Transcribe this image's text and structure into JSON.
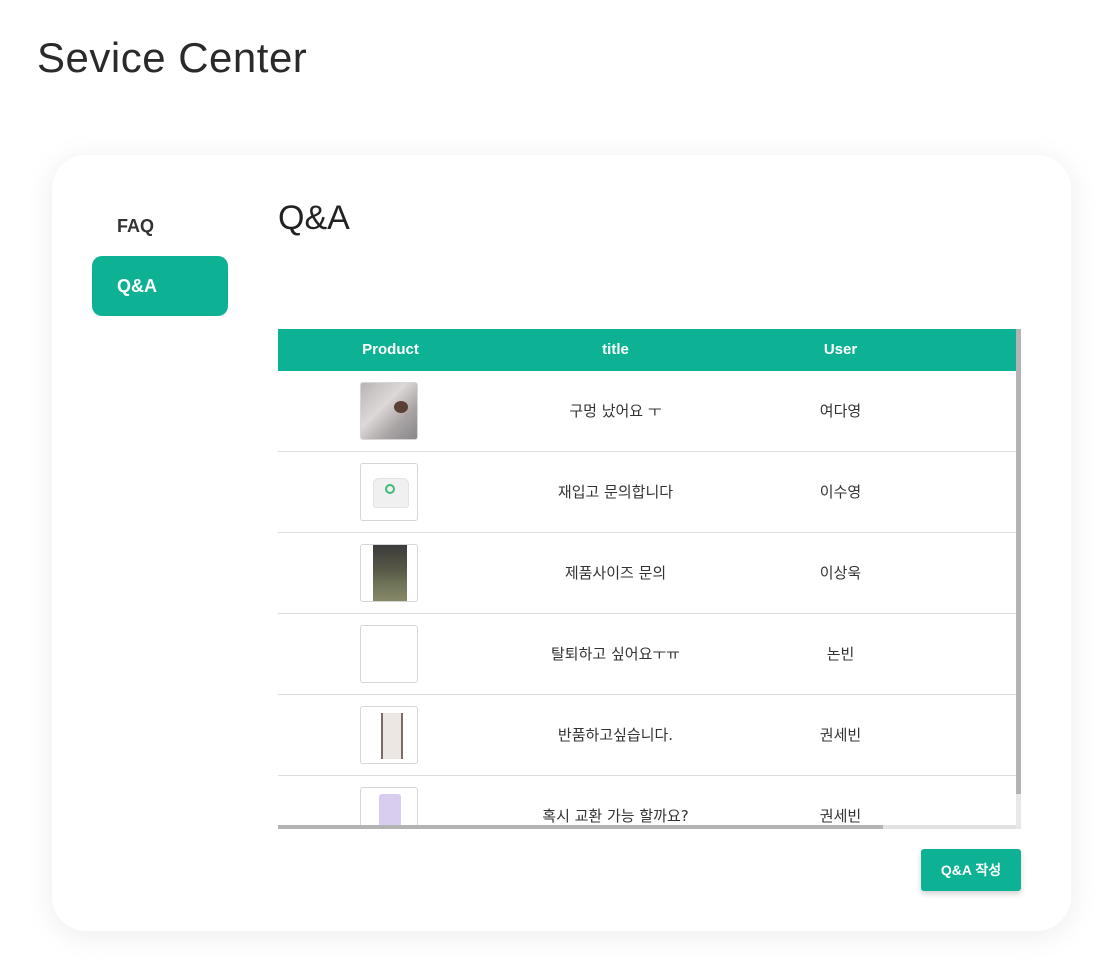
{
  "page": {
    "title": "Sevice Center"
  },
  "sidebar": {
    "items": [
      {
        "label": "FAQ",
        "active": false
      },
      {
        "label": "Q&A",
        "active": true
      }
    ]
  },
  "main": {
    "section_title": "Q&A",
    "table": {
      "headers": [
        "Product",
        "title",
        "User"
      ],
      "rows": [
        {
          "product_icon": "hoodie-photo",
          "title": "구멍 났어요 ㅜ",
          "user": "여다영"
        },
        {
          "product_icon": "sweatshirt-photo",
          "title": "재입고 문의합니다",
          "user": "이수영"
        },
        {
          "product_icon": "outfit-photo",
          "title": "제품사이즈 문의",
          "user": "이상욱"
        },
        {
          "product_icon": "empty-thumbnail",
          "title": "탈퇴하고 싶어요ㅜㅠ",
          "user": "논빈"
        },
        {
          "product_icon": "pants-photo",
          "title": "반품하고싶습니다.",
          "user": "권세빈"
        },
        {
          "product_icon": "lilac-pants-photo",
          "title": "혹시 교환 가능 할까요?",
          "user": "권세빈"
        }
      ]
    },
    "write_button_label": "Q&A 작성"
  },
  "colors": {
    "accent": "#0db194"
  }
}
